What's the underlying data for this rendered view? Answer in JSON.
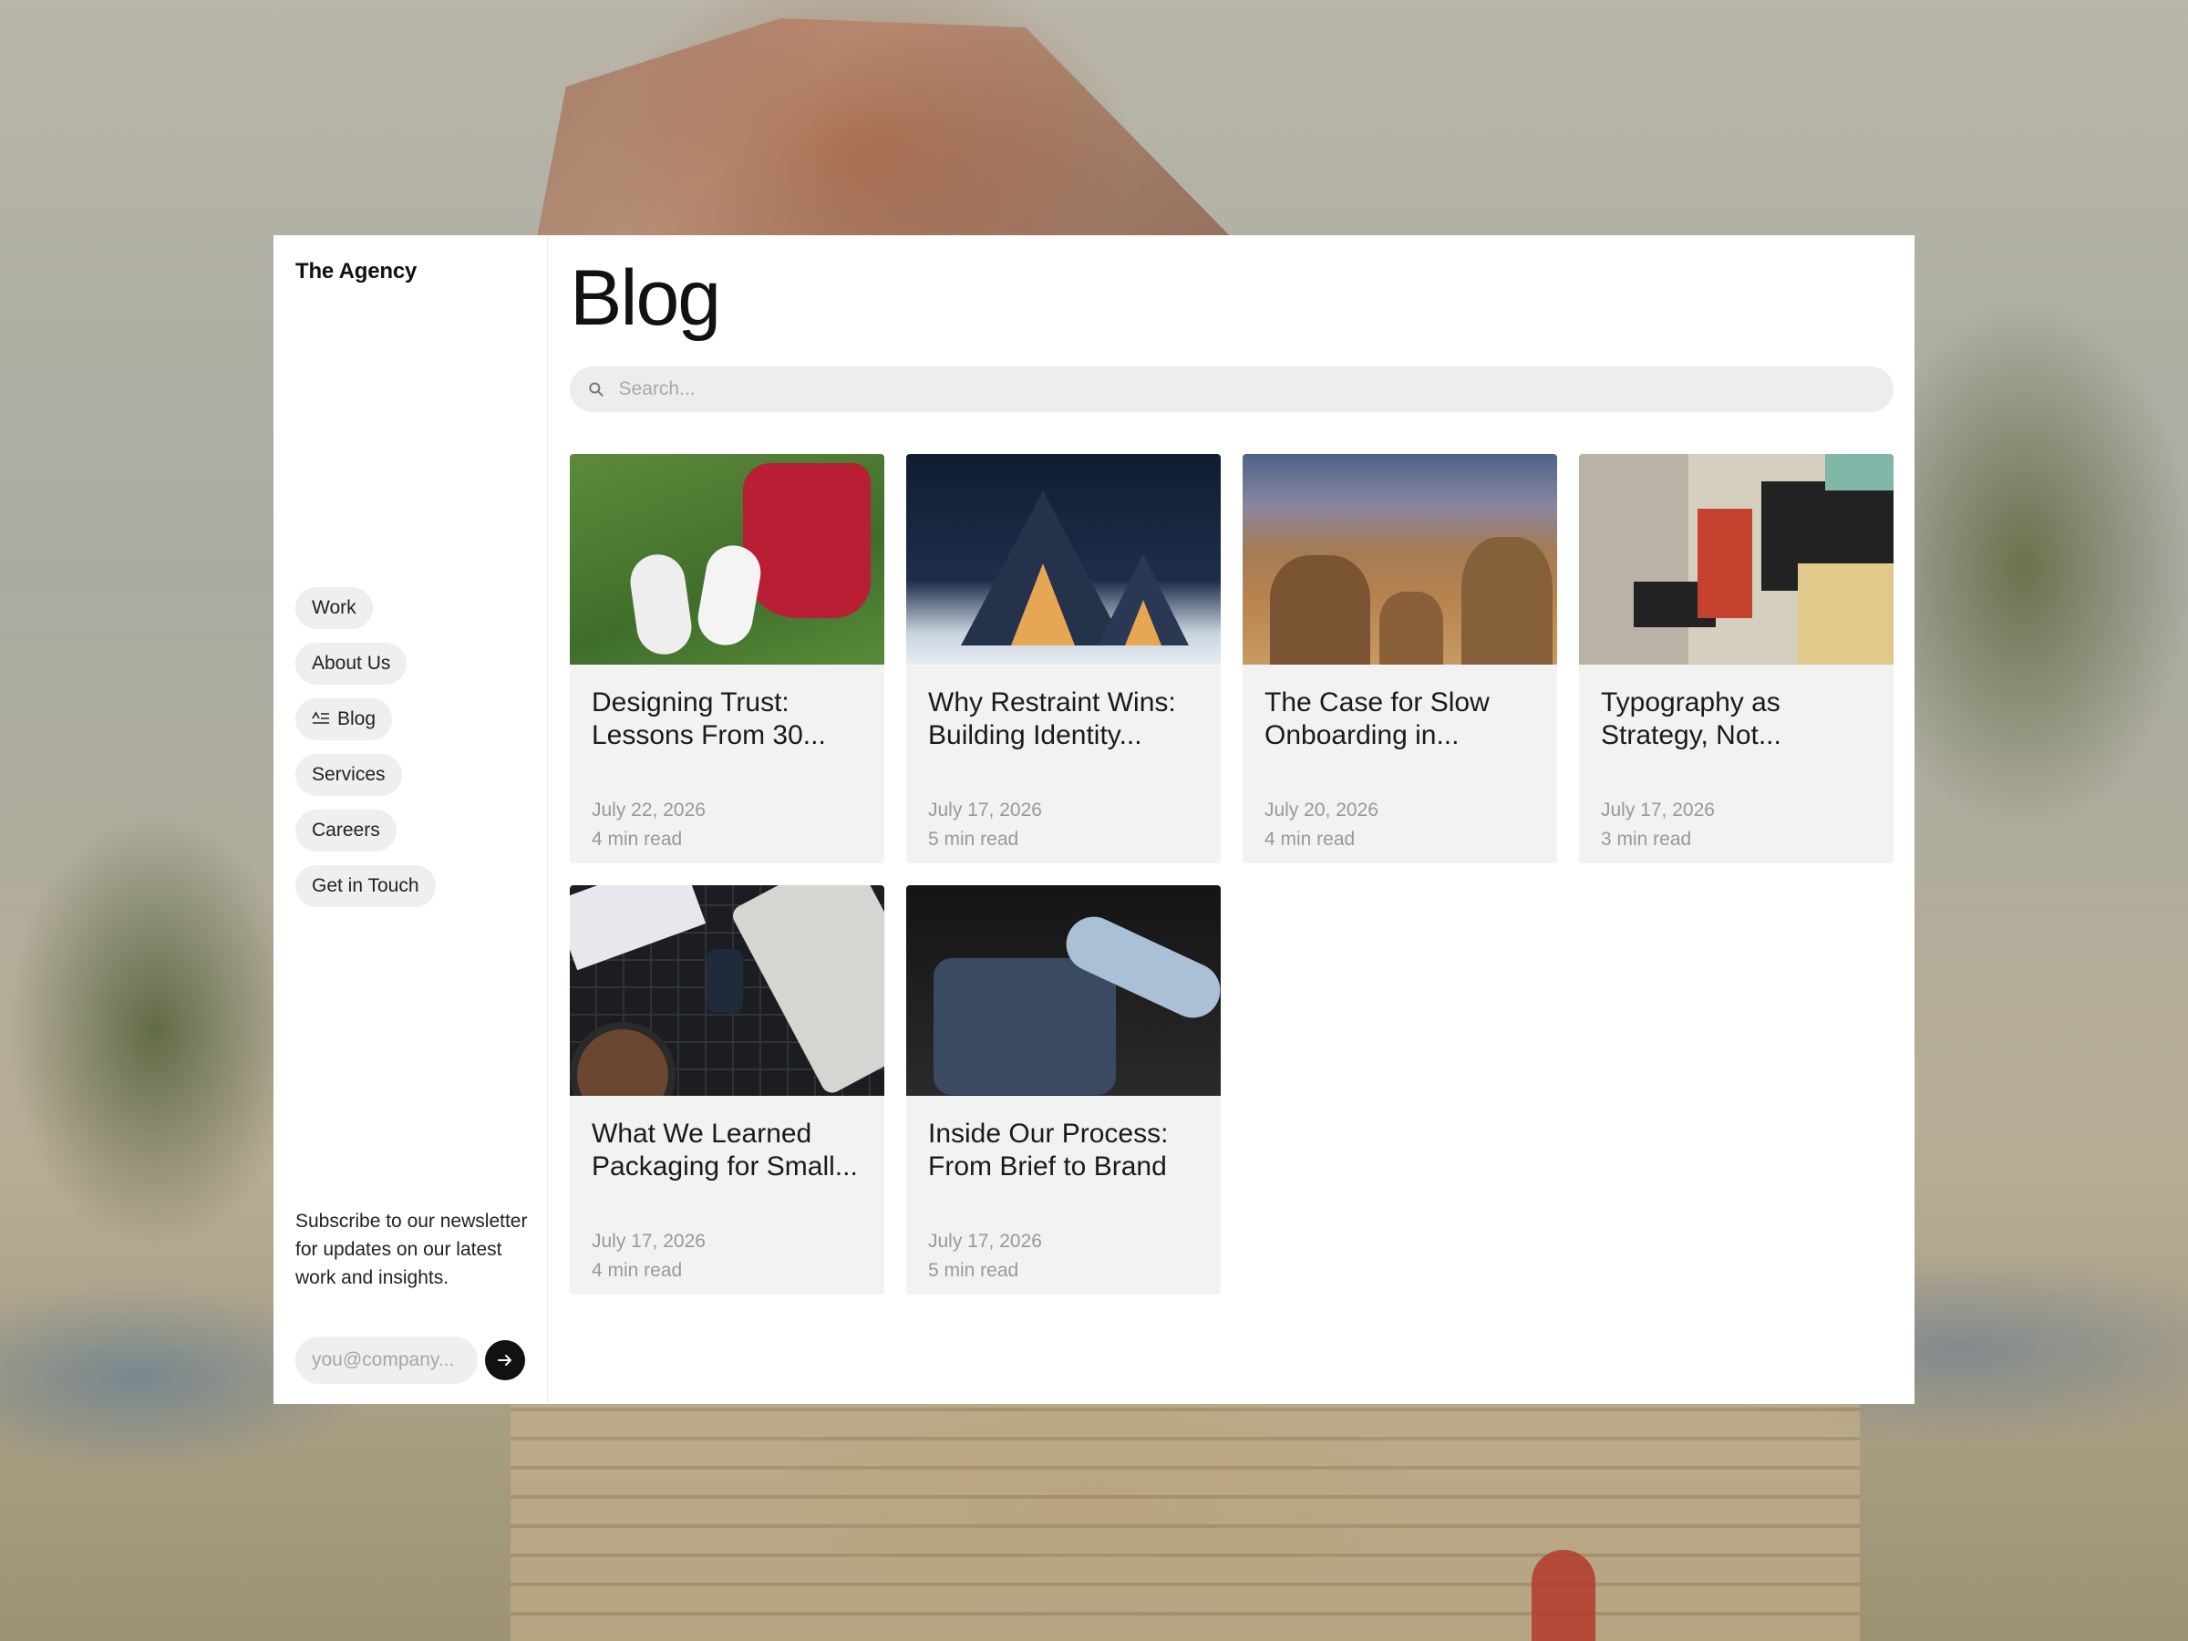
{
  "sidebar": {
    "brand": "The Agency",
    "nav": [
      {
        "label": "Work",
        "active": false
      },
      {
        "label": "About Us",
        "active": false
      },
      {
        "label": "Blog",
        "active": true
      },
      {
        "label": "Services",
        "active": false
      },
      {
        "label": "Careers",
        "active": false
      },
      {
        "label": "Get in Touch",
        "active": false
      }
    ],
    "newsletter_text": "Subscribe to our newsletter for updates on our latest work and insights.",
    "email_placeholder": "you@company...",
    "submit_icon": "arrow-right-icon"
  },
  "main": {
    "title": "Blog",
    "search_placeholder": "Search...",
    "posts": [
      {
        "title": "Designing Trust: Lessons From 30...",
        "date": "July 22, 2026",
        "read_time": "4 min read",
        "image": "sneakers-and-red-bag-on-grass"
      },
      {
        "title": "Why Restraint Wins: Building Identity...",
        "date": "July 17, 2026",
        "read_time": "5 min read",
        "image": "a-frame-cabins-in-snowy-forest"
      },
      {
        "title": "The Case for Slow Onboarding in...",
        "date": "July 20, 2026",
        "read_time": "4 min read",
        "image": "desert-rock-formations"
      },
      {
        "title": "Typography as Strategy, Not...",
        "date": "July 17, 2026",
        "read_time": "3 min read",
        "image": "torn-poster-collage"
      },
      {
        "title": "What We Learned Packaging for Small...",
        "date": "July 17, 2026",
        "read_time": "4 min read",
        "image": "desk-with-notebook-coffee-and-drive"
      },
      {
        "title": "Inside Our Process: From Brief to Brand",
        "date": "July 17, 2026",
        "read_time": "5 min read",
        "image": "hands-packing-backpack"
      }
    ]
  },
  "colors": {
    "panel": "#ffffff",
    "card": "#f2f2f2",
    "pill": "#efefef",
    "muted_text": "#999999",
    "button": "#111111"
  }
}
